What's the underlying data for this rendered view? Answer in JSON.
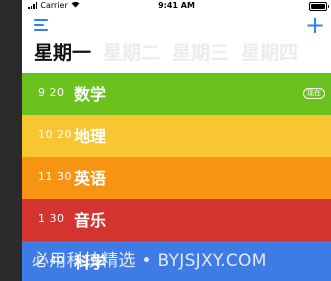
{
  "status": {
    "carrier": "Carrier",
    "time": "9:41 AM"
  },
  "days": [
    "星期一",
    "星期二",
    "星期三",
    "星期四"
  ],
  "classes": [
    {
      "time": "9 20",
      "name": "数学",
      "badge": "现在",
      "color": "#6bc21e"
    },
    {
      "time": "10 20",
      "name": "地理",
      "color": "#f7c630"
    },
    {
      "time": "11 30",
      "name": "英语",
      "color": "#f79411"
    },
    {
      "time": "1 30",
      "name": "音乐",
      "color": "#d3342f"
    },
    {
      "time": "2 40",
      "name": "科学",
      "color": "#3f7be5"
    }
  ],
  "watermark": "必用科技精选 • BYJSJXY.COM"
}
